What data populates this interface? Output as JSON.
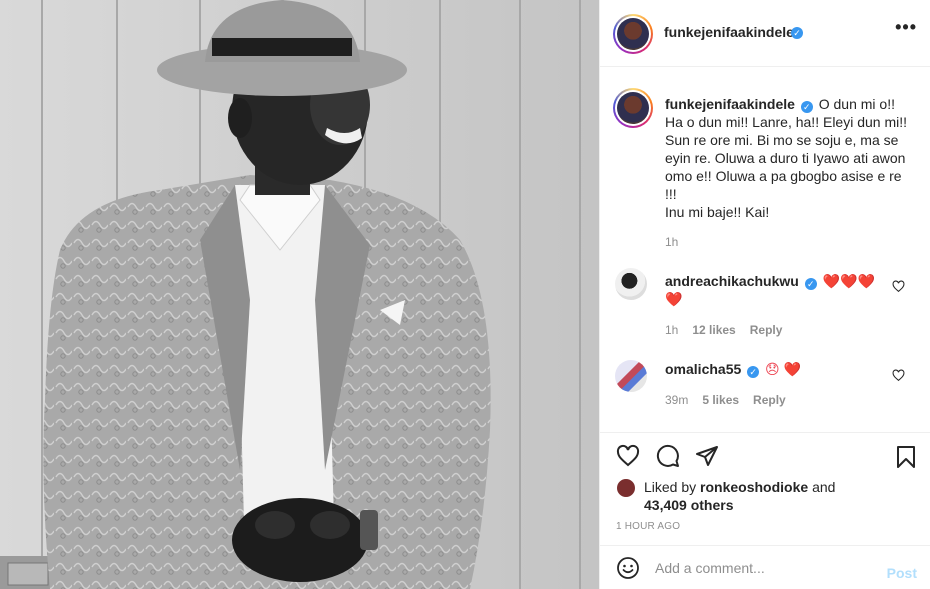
{
  "post": {
    "username": "funkejenifaakindele",
    "verified_mark": "✓",
    "more_icon": "more-horizontal-icon",
    "more_label": "•••",
    "caption_text": "O dun mi o!! Ha o dun mi!! Lanre, ha!! Eleyi dun mi!! Sun re ore mi. Bi mo se soju e, ma se eyin re. Oluwa a duro ti Iyawo ati awon omo e!! Oluwa a pa gbogbo asise e re !!!",
    "caption_line2": "Inu mi baje!! Kai!",
    "caption_age": "1h"
  },
  "comments": [
    {
      "username": "andreachikachukwu",
      "text": "❤️❤️❤️ ❤️",
      "age": "1h",
      "likes": "12 likes",
      "reply": "Reply"
    },
    {
      "username": "omalicha55",
      "text": "😞 ❤️",
      "age": "39m",
      "likes": "5 likes",
      "reply": "Reply"
    }
  ],
  "likes_summary": {
    "liked_by_prefix": "Liked by",
    "liked_by_user": "ronkeoshodioke",
    "and": "and",
    "others": "43,409 others"
  },
  "timestamp": "1 HOUR AGO",
  "add_comment": {
    "placeholder": "Add a comment...",
    "post_label": "Post"
  },
  "icons": {
    "like": "heart-icon",
    "comment": "comment-icon",
    "share": "send-icon",
    "save": "bookmark-icon",
    "emoji": "emoji-icon"
  },
  "colors": {
    "verified": "#3897f0",
    "post_button_disabled": "#b2dffc",
    "muted_text": "#8e8e8e",
    "heart_red": "#ed4956"
  }
}
